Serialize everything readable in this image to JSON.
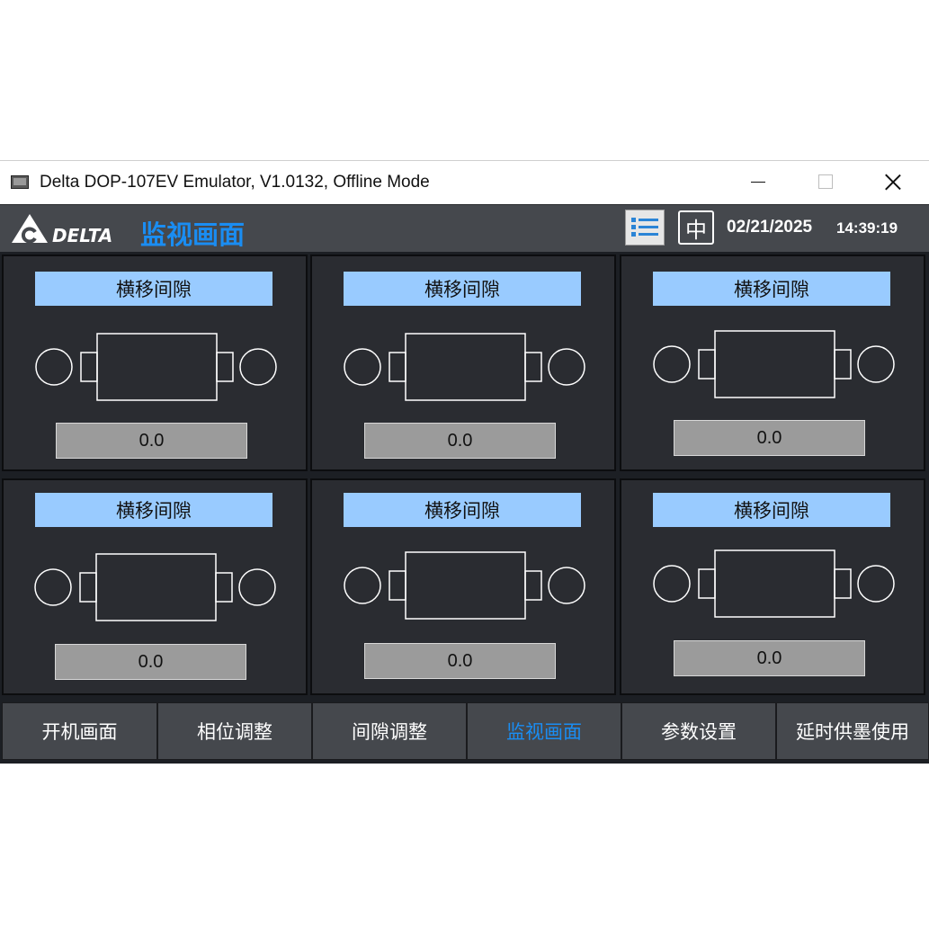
{
  "window": {
    "title": "Delta DOP-107EV Emulator, V1.0132, Offline Mode"
  },
  "header": {
    "logo_text": "DELTA",
    "page_title": "监视画面",
    "lang_label": "中",
    "date": "02/21/2025",
    "time": "14:39:19"
  },
  "panels": [
    {
      "label": "横移间隙",
      "value": "0.0"
    },
    {
      "label": "横移间隙",
      "value": "0.0"
    },
    {
      "label": "横移间隙",
      "value": "0.0"
    },
    {
      "label": "横移间隙",
      "value": "0.0"
    },
    {
      "label": "横移间隙",
      "value": "0.0"
    },
    {
      "label": "横移间隙",
      "value": "0.0"
    }
  ],
  "nav": {
    "items": [
      {
        "label": "开机画面",
        "active": false
      },
      {
        "label": "相位调整",
        "active": false
      },
      {
        "label": "间隙调整",
        "active": false
      },
      {
        "label": "监视画面",
        "active": true
      },
      {
        "label": "参数设置",
        "active": false
      },
      {
        "label": "延时供墨使用",
        "active": false
      }
    ]
  },
  "colors": {
    "accent": "#1a8df2",
    "label_bg": "#99cbff",
    "header_bg": "#45484d",
    "panel_bg": "#2a2c31"
  },
  "icons": [
    "app-icon",
    "minimize-icon",
    "maximize-icon",
    "close-icon",
    "delta-logo-icon",
    "menu-list-icon",
    "roller-diagram-icon"
  ]
}
